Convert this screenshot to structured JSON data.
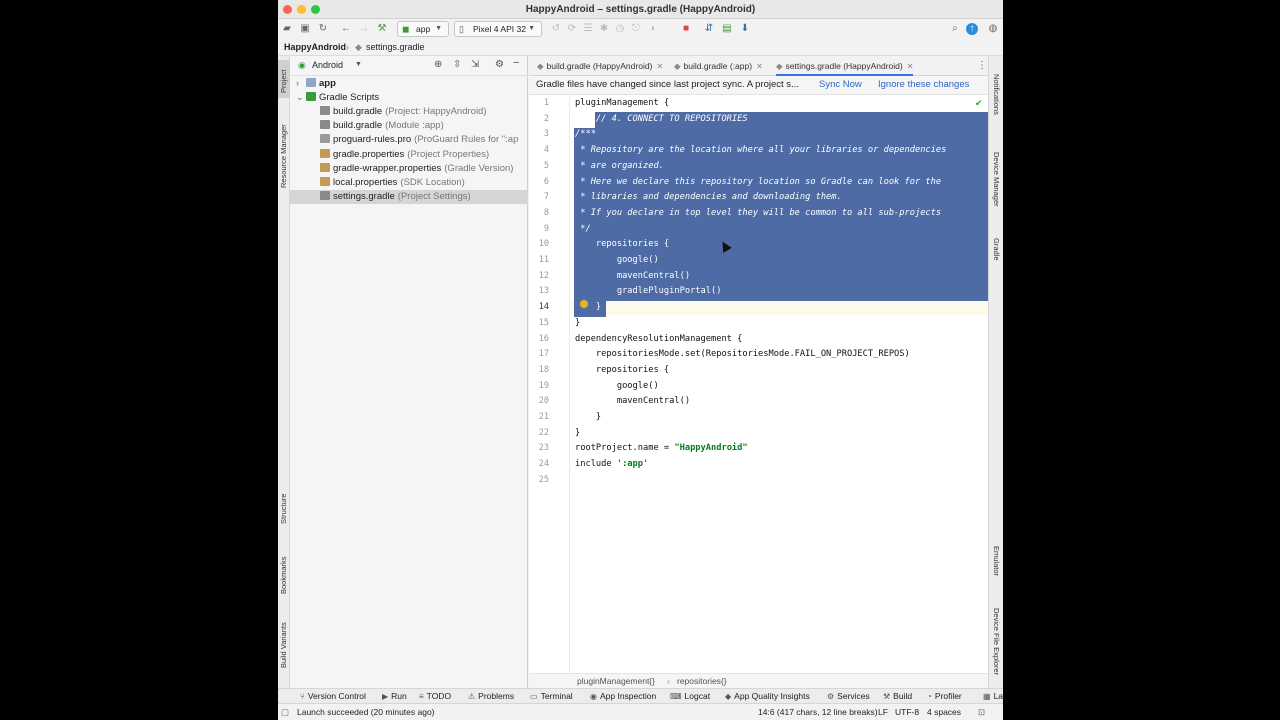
{
  "window": {
    "title": "HappyAndroid – settings.gradle (HappyAndroid)",
    "traffic_colors": [
      "#ff5f57",
      "#febc2e",
      "#28c840"
    ]
  },
  "toolbar": {
    "run_config": "app",
    "device": "Pixel 4 API 32"
  },
  "breadcrumb": {
    "project": "HappyAndroid",
    "file": "settings.gradle"
  },
  "left_stripe": {
    "top": [
      "Project",
      "Resource Manager"
    ],
    "bottom": [
      "Structure",
      "Bookmarks",
      "Build Variants"
    ]
  },
  "right_stripe": {
    "top": [
      "Notifications",
      "Device Manager",
      "Gradle"
    ],
    "bottom": [
      "Emulator",
      "Device File Explorer"
    ]
  },
  "project_panel": {
    "view": "Android",
    "tree": [
      {
        "label": "app",
        "hint": "",
        "level": 0,
        "bold": true,
        "arrow": "›",
        "icon": "folder-icon"
      },
      {
        "label": "Gradle Scripts",
        "hint": "",
        "level": 0,
        "bold": false,
        "arrow": "⌄",
        "icon": "gradle-scripts-icon"
      },
      {
        "label": "build.gradle",
        "hint": "(Project: HappyAndroid)",
        "level": 1,
        "icon": "gradle-file-icon"
      },
      {
        "label": "build.gradle",
        "hint": "(Module :app)",
        "level": 1,
        "icon": "gradle-file-icon"
      },
      {
        "label": "proguard-rules.pro",
        "hint": "(ProGuard Rules for \":ap",
        "level": 1,
        "icon": "text-file-icon"
      },
      {
        "label": "gradle.properties",
        "hint": "(Project Properties)",
        "level": 1,
        "icon": "properties-file-icon"
      },
      {
        "label": "gradle-wrapper.properties",
        "hint": "(Gradle Version)",
        "level": 1,
        "icon": "properties-file-icon"
      },
      {
        "label": "local.properties",
        "hint": "(SDK Location)",
        "level": 1,
        "icon": "properties-file-icon"
      },
      {
        "label": "settings.gradle",
        "hint": "(Project Settings)",
        "level": 1,
        "icon": "gradle-file-icon",
        "selected": true
      }
    ]
  },
  "tabs": [
    {
      "label": "build.gradle (HappyAndroid)",
      "active": false
    },
    {
      "label": "build.gradle (:app)",
      "active": false
    },
    {
      "label": "settings.gradle (HappyAndroid)",
      "active": true
    }
  ],
  "banner": {
    "message": "Gradle files have changed since last project sync. A project s...",
    "sync_now": "Sync Now",
    "ignore": "Ignore these changes"
  },
  "editor": {
    "current_line": 14,
    "lines": [
      {
        "n": 1,
        "text": "pluginManagement {"
      },
      {
        "n": 2,
        "text": "    // 4. CONNECT TO REPOSITORIES"
      },
      {
        "n": 3,
        "text": "/***"
      },
      {
        "n": 4,
        "text": " * Repository are the location where all your libraries or dependencies"
      },
      {
        "n": 5,
        "text": " * are organized."
      },
      {
        "n": 6,
        "text": " * Here we declare this repository location so Gradle can look for the"
      },
      {
        "n": 7,
        "text": " * libraries and dependencies and downloading them."
      },
      {
        "n": 8,
        "text": " * If you declare in top level they will be common to all sub-projects"
      },
      {
        "n": 9,
        "text": " */"
      },
      {
        "n": 10,
        "text": "    repositories {"
      },
      {
        "n": 11,
        "text": "        google()"
      },
      {
        "n": 12,
        "text": "        mavenCentral()"
      },
      {
        "n": 13,
        "text": "        gradlePluginPortal()"
      },
      {
        "n": 14,
        "text": "    }"
      },
      {
        "n": 15,
        "text": "}"
      },
      {
        "n": 16,
        "text": "dependencyResolutionManagement {"
      },
      {
        "n": 17,
        "text": "    repositoriesMode.set(RepositoriesMode.FAIL_ON_PROJECT_REPOS)"
      },
      {
        "n": 18,
        "text": "    repositories {"
      },
      {
        "n": 19,
        "text": "        google()"
      },
      {
        "n": 20,
        "text": "        mavenCentral()"
      },
      {
        "n": 21,
        "text": "    }"
      },
      {
        "n": 22,
        "text": "}"
      },
      {
        "n": 23,
        "text": "rootProject.name = ",
        "str": "\"HappyAndroid\""
      },
      {
        "n": 24,
        "text": "include ",
        "str": "':app'"
      },
      {
        "n": 25,
        "text": ""
      }
    ],
    "crumbs": [
      "pluginManagement{}",
      "repositories{}"
    ]
  },
  "bottom_tools": [
    {
      "label": "Version Control",
      "icon": "version-control-icon",
      "glyph": "⑂"
    },
    {
      "label": "Run",
      "icon": "run-icon",
      "glyph": "▶"
    },
    {
      "label": "TODO",
      "icon": "todo-icon",
      "glyph": "≡"
    },
    {
      "label": "Problems",
      "icon": "problems-icon",
      "glyph": "⚠"
    },
    {
      "label": "Terminal",
      "icon": "terminal-icon",
      "glyph": "▭"
    },
    {
      "label": "App Inspection",
      "icon": "app-inspection-icon",
      "glyph": "◉"
    },
    {
      "label": "Logcat",
      "icon": "logcat-icon",
      "glyph": "⌨"
    },
    {
      "label": "App Quality Insights",
      "icon": "app-quality-icon",
      "glyph": "◆"
    },
    {
      "label": "Services",
      "icon": "services-icon",
      "glyph": "⚙"
    },
    {
      "label": "Build",
      "icon": "build-hammer-icon",
      "glyph": "⚒"
    },
    {
      "label": "Profiler",
      "icon": "profiler-icon",
      "glyph": "◔"
    },
    {
      "label": "La",
      "icon": "layout-inspector-icon",
      "glyph": "▦"
    }
  ],
  "status": {
    "message": "Launch succeeded (20 minutes ago)",
    "position": "14:6 (417 chars, 12 line breaks)",
    "line_sep": "LF",
    "encoding": "UTF-8",
    "indent": "4 spaces"
  },
  "colors": {
    "selection": "#4e6ba6",
    "link": "#2f65ca",
    "accent": "#3574f0",
    "gradle_green": "#3b9b3b"
  }
}
